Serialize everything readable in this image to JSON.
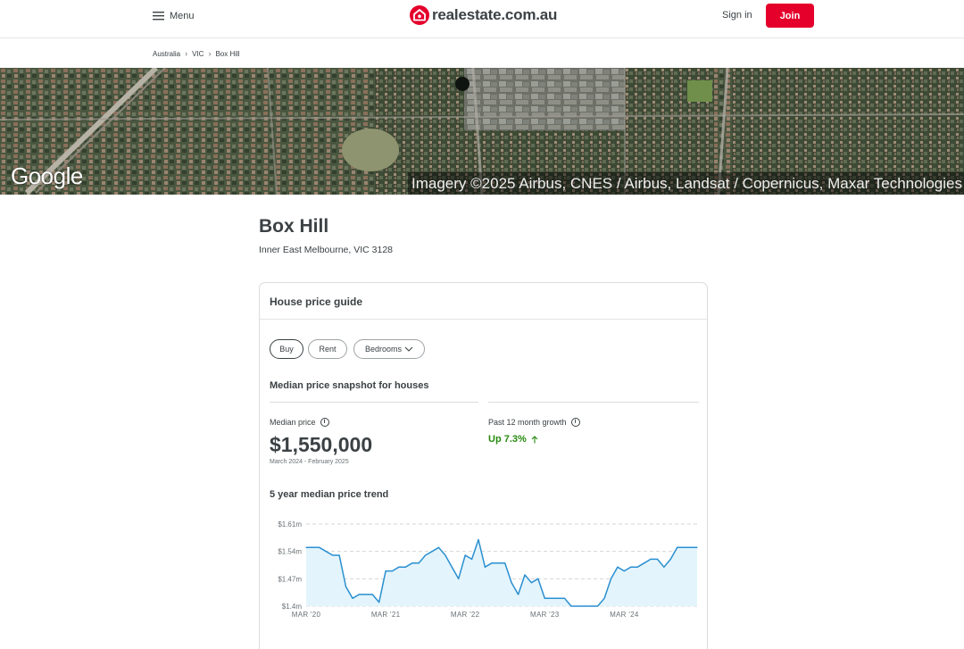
{
  "header": {
    "menu_label": "Menu",
    "logo_text": "realestate.com.au",
    "signin_label": "Sign in",
    "join_label": "Join"
  },
  "breadcrumb": [
    "Australia",
    "VIC",
    "Box Hill"
  ],
  "map": {
    "google_label": "Google",
    "imagery_text": "Imagery ©2025 Airbus, CNES / Airbus, Landsat / Copernicus, Maxar Technologies"
  },
  "suburb": {
    "name": "Box Hill",
    "subtitle": "Inner East Melbourne, VIC 3128"
  },
  "price_guide": {
    "title": "House price guide",
    "tabs": [
      "Buy",
      "Rent",
      "Bedrooms"
    ],
    "active_tab": "Buy",
    "snapshot_title": "Median price snapshot for houses",
    "median_label": "Median price",
    "median_value": "$1,550,000",
    "median_range": "March 2024 - February 2025",
    "growth_label": "Past 12 month growth",
    "growth_value": "Up 7.3%",
    "trend_title": "5 year median price trend"
  },
  "colors": {
    "brand_red": "#e4002b",
    "growth_green": "#26890d",
    "line_blue": "#2a8fd0",
    "area_fill": "#e3f4fc"
  },
  "chart_data": {
    "type": "area",
    "title": "5 year median price trend",
    "xlabel": "",
    "ylabel": "",
    "y_tick_labels": [
      "$1.61m",
      "$1.54m",
      "$1.47m",
      "$1.4m"
    ],
    "y_ticks": [
      1.61,
      1.54,
      1.47,
      1.4
    ],
    "ylim": [
      1.4,
      1.61
    ],
    "x_tick_labels": [
      "MAR '20",
      "MAR '21",
      "MAR '22",
      "MAR '23",
      "MAR '24"
    ],
    "x_ticks": [
      0,
      12,
      24,
      36,
      48
    ],
    "xlim": [
      0,
      59
    ],
    "grid": true,
    "series": [
      {
        "x": [
          0,
          1,
          2,
          3,
          4,
          5,
          6,
          7,
          8,
          9,
          10,
          11,
          12,
          13,
          14,
          15,
          16,
          17,
          18,
          19,
          20,
          21,
          22,
          23,
          24,
          25,
          26,
          27,
          28,
          29,
          30,
          31,
          32,
          33,
          34,
          35,
          36,
          37,
          38,
          39,
          40,
          41,
          42,
          43,
          44,
          45,
          46,
          47,
          48,
          49,
          50,
          51,
          52,
          53,
          54,
          55,
          56,
          57,
          58,
          59
        ],
        "values": [
          1.55,
          1.55,
          1.55,
          1.54,
          1.53,
          1.53,
          1.45,
          1.42,
          1.43,
          1.43,
          1.43,
          1.41,
          1.49,
          1.49,
          1.5,
          1.5,
          1.51,
          1.51,
          1.53,
          1.54,
          1.55,
          1.53,
          1.5,
          1.47,
          1.53,
          1.52,
          1.57,
          1.5,
          1.51,
          1.51,
          1.51,
          1.46,
          1.43,
          1.48,
          1.46,
          1.47,
          1.42,
          1.42,
          1.42,
          1.42,
          1.4,
          1.4,
          1.4,
          1.4,
          1.4,
          1.42,
          1.47,
          1.5,
          1.49,
          1.5,
          1.5,
          1.51,
          1.52,
          1.52,
          1.5,
          1.52,
          1.55,
          1.55,
          1.55,
          1.55
        ]
      }
    ]
  }
}
